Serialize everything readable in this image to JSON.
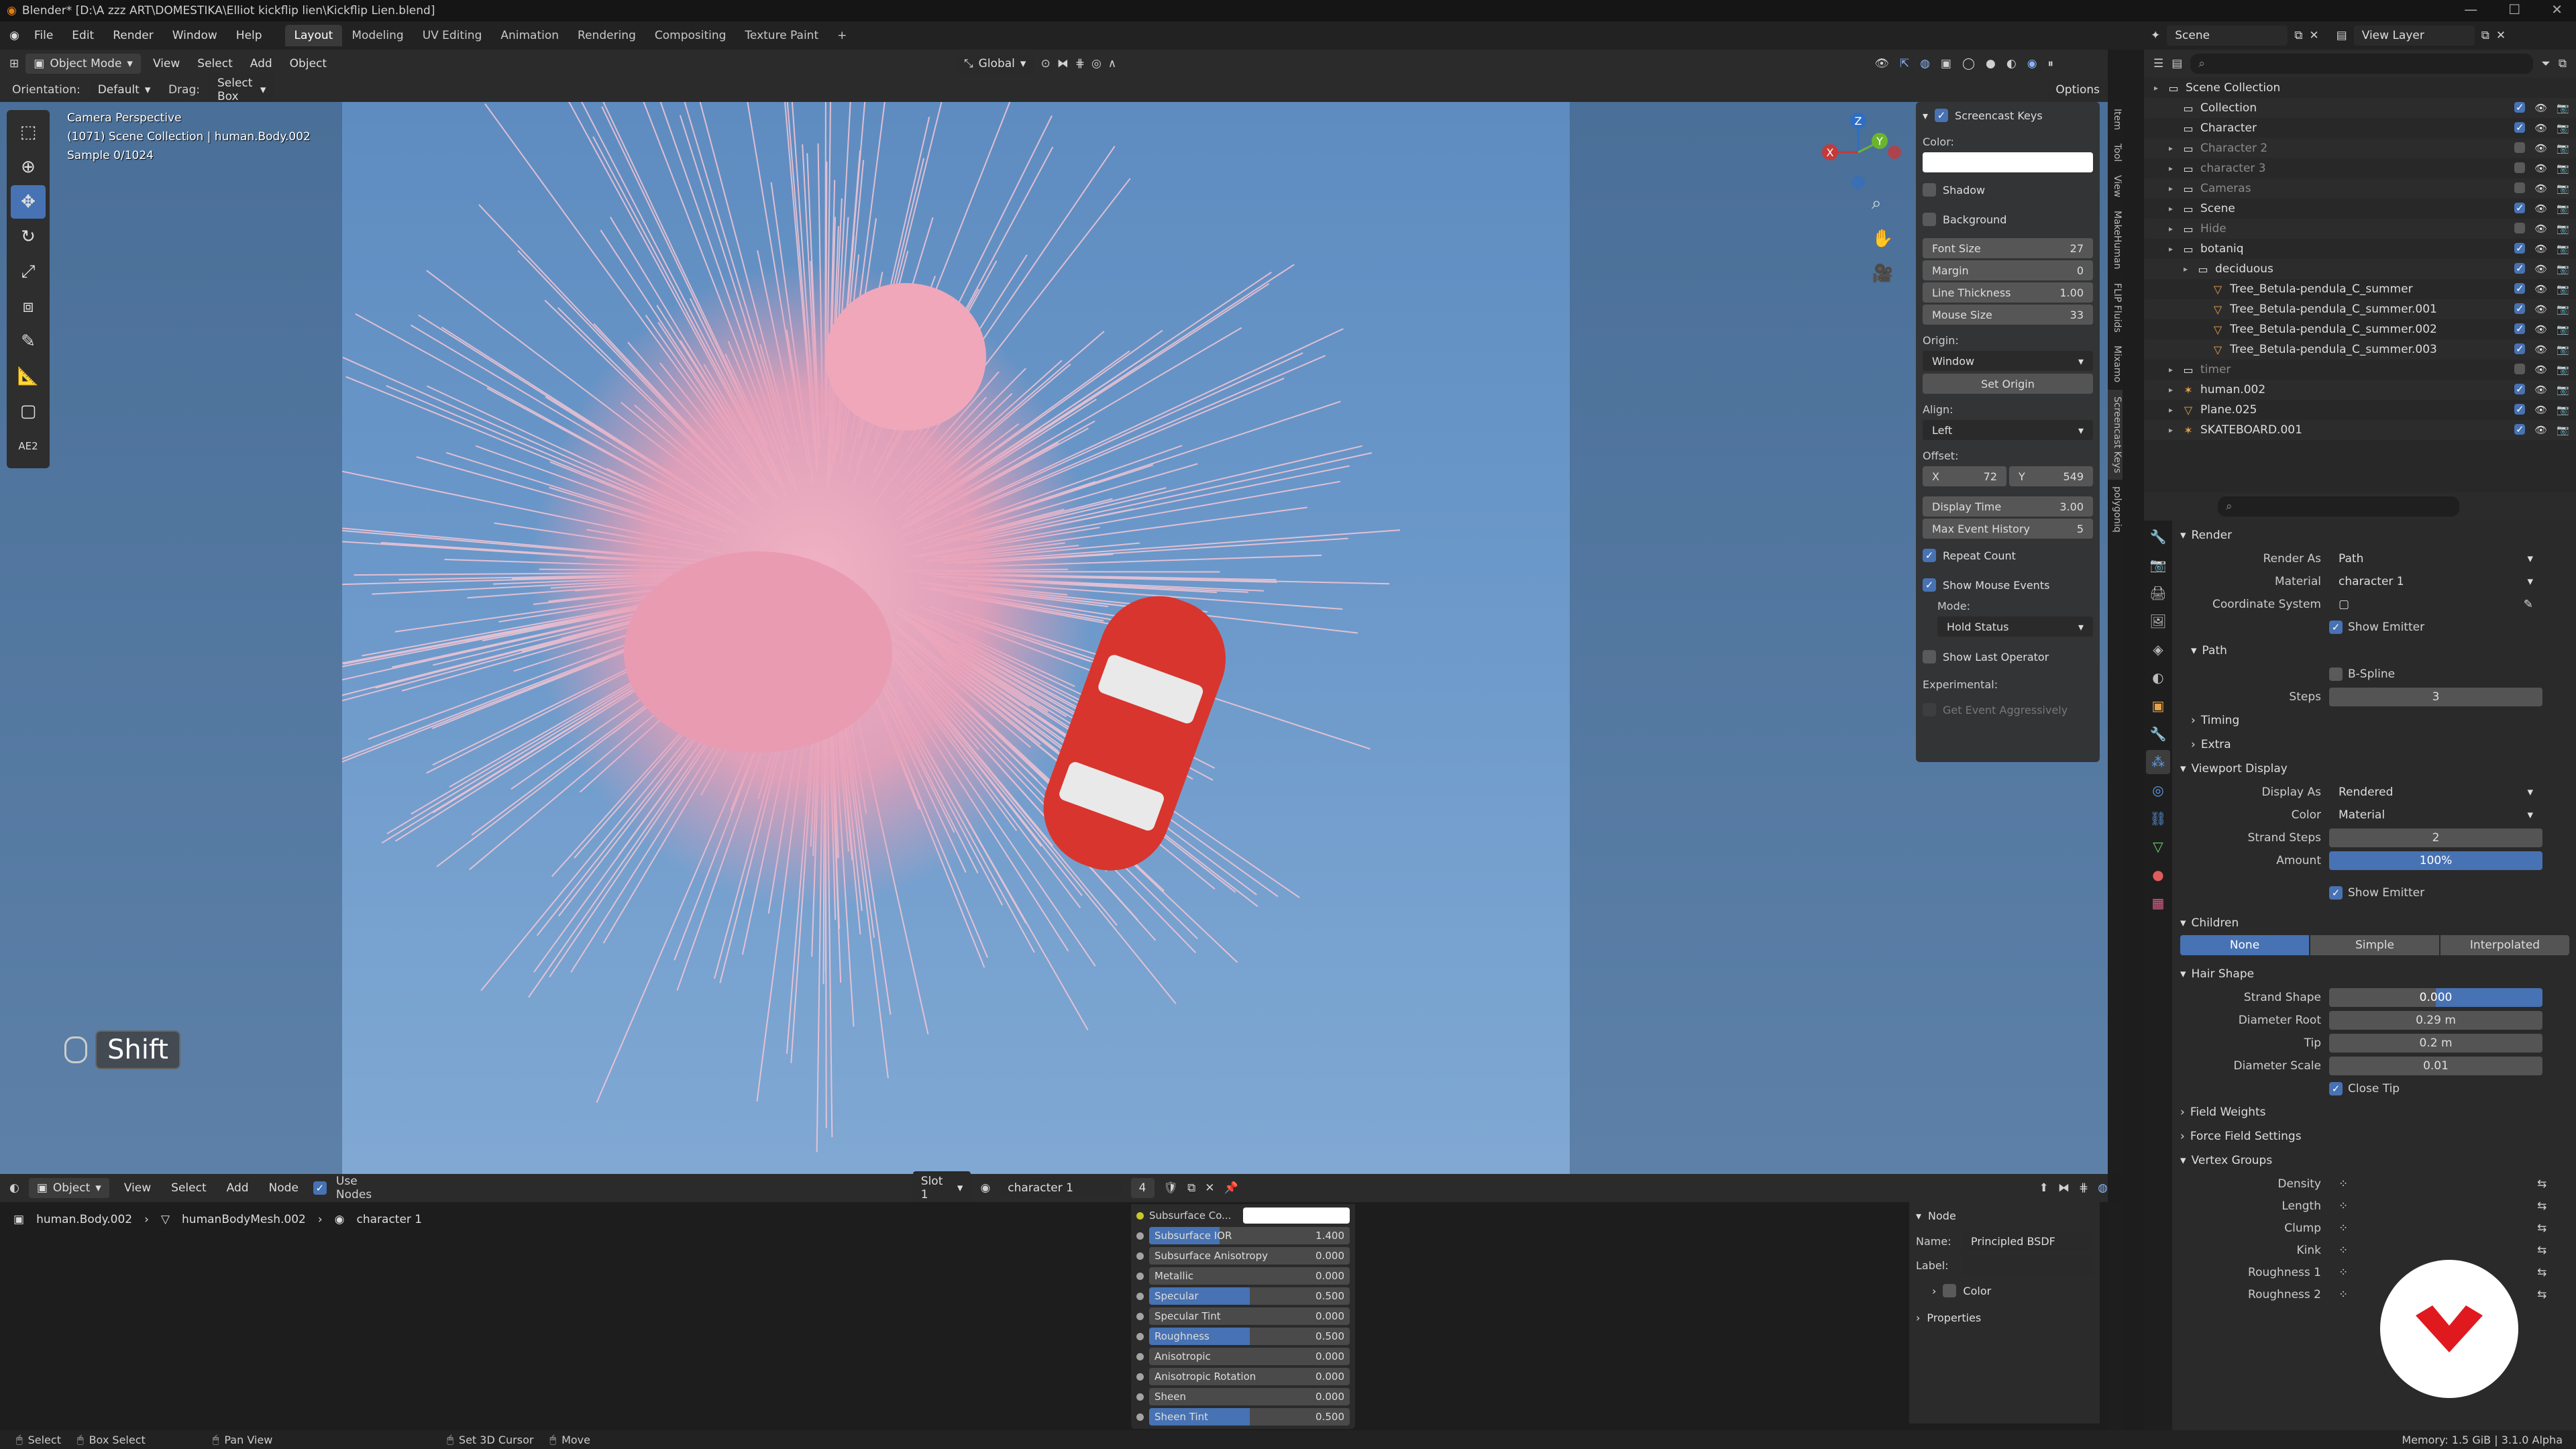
{
  "window": {
    "title": "Blender* [D:\\A zzz ART\\DOMESTIKA\\Elliot kickflip lien\\Kickflip Lien.blend]"
  },
  "menubar": {
    "items": [
      "File",
      "Edit",
      "Render",
      "Window",
      "Help"
    ],
    "workspaces": [
      "Layout",
      "Modeling",
      "UV Editing",
      "Animation",
      "Rendering",
      "Compositing",
      "Texture Paint"
    ],
    "active_workspace": "Layout",
    "scene_label": "Scene",
    "view_layer_label": "View Layer"
  },
  "viewport_header": {
    "mode": "Object Mode",
    "menus": [
      "View",
      "Select",
      "Add",
      "Object"
    ],
    "transform": "Global",
    "orientation_label": "Orientation:",
    "orientation_value": "Default",
    "drag_label": "Drag:",
    "drag_value": "Select Box",
    "options_label": "Options"
  },
  "viewport": {
    "overlay_lines": [
      "Camera Perspective",
      "(1071) Scene Collection | human.Body.002",
      "Sample 0/1024"
    ],
    "screencast_key": "Shift",
    "toolbar_label": "AE2"
  },
  "gizmo": {
    "x": "X",
    "y": "Y",
    "z": "Z"
  },
  "screencast_panel": {
    "title": "Screencast Keys",
    "color_label": "Color:",
    "color_value": "#ffffff",
    "shadow": "Shadow",
    "background": "Background",
    "fields": [
      {
        "label": "Font Size",
        "value": "27"
      },
      {
        "label": "Margin",
        "value": "0"
      },
      {
        "label": "Line Thickness",
        "value": "1.00"
      },
      {
        "label": "Mouse Size",
        "value": "33"
      }
    ],
    "origin_label": "Origin:",
    "origin_value": "Window",
    "set_origin": "Set Origin",
    "align_label": "Align:",
    "align_value": "Left",
    "offset_label": "Offset:",
    "offset_x_label": "X",
    "offset_x": "72",
    "offset_y_label": "Y",
    "offset_y": "549",
    "display_time_label": "Display Time",
    "display_time": "3.00",
    "max_history_label": "Max Event History",
    "max_history": "5",
    "repeat_count": "Repeat Count",
    "show_mouse_events": "Show Mouse Events",
    "mode_label": "Mode:",
    "mode_value": "Hold Status",
    "show_last_operator": "Show Last Operator",
    "experimental_label": "Experimental:",
    "get_event": "Get Event Aggressively"
  },
  "side_tabs": [
    "Item",
    "Tool",
    "View",
    "MakeHuman",
    "FLIP Fluids",
    "Mixamo",
    "Screencast Keys",
    "polygoniq"
  ],
  "outliner": {
    "search_placeholder": "",
    "rows": [
      {
        "label": "Scene Collection",
        "indent": 0,
        "icon": "collection-icon",
        "dim": false
      },
      {
        "label": "Collection",
        "indent": 1,
        "icon": "collection-icon",
        "dim": false
      },
      {
        "label": "Character",
        "indent": 1,
        "icon": "collection-icon",
        "dim": false
      },
      {
        "label": "Character 2",
        "indent": 1,
        "icon": "collection-icon",
        "dim": true
      },
      {
        "label": "character 3",
        "indent": 1,
        "icon": "collection-icon",
        "dim": true
      },
      {
        "label": "Cameras",
        "indent": 1,
        "icon": "collection-icon",
        "dim": true
      },
      {
        "label": "Scene",
        "indent": 1,
        "icon": "collection-icon",
        "dim": false
      },
      {
        "label": "Hide",
        "indent": 1,
        "icon": "collection-icon",
        "dim": true
      },
      {
        "label": "botaniq",
        "indent": 1,
        "icon": "collection-icon",
        "dim": false
      },
      {
        "label": "deciduous",
        "indent": 2,
        "icon": "collection-icon",
        "dim": false
      },
      {
        "label": "Tree_Betula-pendula_C_summer",
        "indent": 3,
        "icon": "mesh-icon",
        "dim": false
      },
      {
        "label": "Tree_Betula-pendula_C_summer.001",
        "indent": 3,
        "icon": "mesh-icon",
        "dim": false
      },
      {
        "label": "Tree_Betula-pendula_C_summer.002",
        "indent": 3,
        "icon": "mesh-icon",
        "dim": false
      },
      {
        "label": "Tree_Betula-pendula_C_summer.003",
        "indent": 3,
        "icon": "mesh-icon",
        "dim": false
      },
      {
        "label": "timer",
        "indent": 1,
        "icon": "collection-icon",
        "dim": true
      },
      {
        "label": "human.002",
        "indent": 1,
        "icon": "armature-icon",
        "dim": false
      },
      {
        "label": "Plane.025",
        "indent": 1,
        "icon": "mesh-icon",
        "dim": false
      },
      {
        "label": "SKATEBOARD.001",
        "indent": 1,
        "icon": "armature-icon",
        "dim": false
      }
    ]
  },
  "properties": {
    "render_section": "Render",
    "render_as_label": "Render As",
    "render_as": "Path",
    "material_label": "Material",
    "material": "character 1",
    "coord_label": "Coordinate System",
    "show_emitter": "Show Emitter",
    "path_section": "Path",
    "bspline": "B-Spline",
    "steps_label": "Steps",
    "steps": "3",
    "timing": "Timing",
    "extra": "Extra",
    "viewport_display": "Viewport Display",
    "display_as_label": "Display As",
    "display_as": "Rendered",
    "color_label": "Color",
    "color": "Material",
    "strand_steps_label": "Strand Steps",
    "strand_steps": "2",
    "amount_label": "Amount",
    "amount": "100%",
    "show_emitter2": "Show Emitter",
    "children": "Children",
    "children_modes": [
      "None",
      "Simple",
      "Interpolated"
    ],
    "children_active": "None",
    "hair_shape": "Hair Shape",
    "strand_shape_label": "Strand Shape",
    "strand_shape": "0.000",
    "diam_root_label": "Diameter Root",
    "diam_root": "0.29 m",
    "tip_label": "Tip",
    "tip": "0.2 m",
    "diam_scale_label": "Diameter Scale",
    "diam_scale": "0.01",
    "close_tip": "Close Tip",
    "field_weights": "Field Weights",
    "force_field": "Force Field Settings",
    "vertex_groups": "Vertex Groups",
    "vg_rows": [
      "Density",
      "Length",
      "Clump",
      "Kink",
      "Roughness 1",
      "Roughness 2"
    ]
  },
  "node_editor": {
    "header_mode": "Object",
    "menus": [
      "View",
      "Select",
      "Add",
      "Node"
    ],
    "use_nodes": "Use Nodes",
    "slot": "Slot 1",
    "material": "character 1",
    "users": "4",
    "breadcrumb": [
      "human.Body.002",
      "humanBodyMesh.002",
      "character 1"
    ],
    "inputs": [
      {
        "label": "Subsurface Co...",
        "value": "",
        "fill": 0,
        "color": true
      },
      {
        "label": "Subsurface IOR",
        "value": "1.400",
        "fill": 0.35
      },
      {
        "label": "Subsurface Anisotropy",
        "value": "0.000",
        "fill": 0
      },
      {
        "label": "Metallic",
        "value": "0.000",
        "fill": 0
      },
      {
        "label": "Specular",
        "value": "0.500",
        "fill": 0.5
      },
      {
        "label": "Specular Tint",
        "value": "0.000",
        "fill": 0
      },
      {
        "label": "Roughness",
        "value": "0.500",
        "fill": 0.5
      },
      {
        "label": "Anisotropic",
        "value": "0.000",
        "fill": 0
      },
      {
        "label": "Anisotropic Rotation",
        "value": "0.000",
        "fill": 0
      },
      {
        "label": "Sheen",
        "value": "0.000",
        "fill": 0
      },
      {
        "label": "Sheen Tint",
        "value": "0.500",
        "fill": 0.5
      }
    ],
    "side_node": "Node",
    "name_label": "Name:",
    "name_value": "Principled BSDF",
    "label_label": "Label:",
    "color_section": "Color",
    "properties_section": "Properties"
  },
  "statusbar": {
    "items": [
      "Select",
      "Box Select",
      "Pan View",
      "Set 3D Cursor",
      "Move"
    ],
    "memory": "Memory: 1.5 GiB | 3.1.0 Alpha"
  }
}
